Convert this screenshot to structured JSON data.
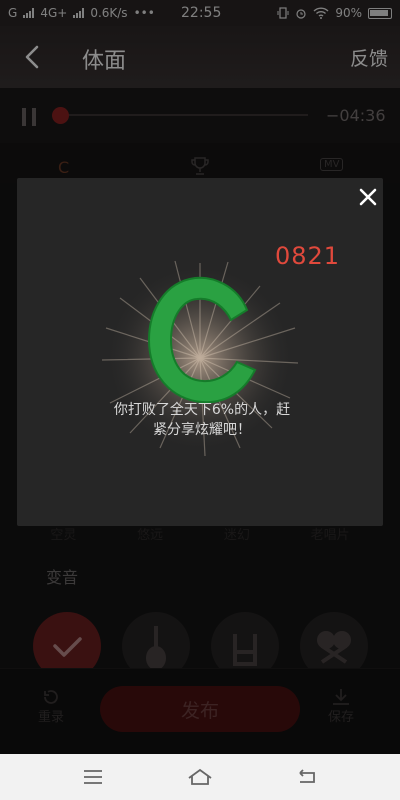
{
  "status_bar": {
    "carrier_left": "G",
    "network": "4G+",
    "speed": "0.6K/s",
    "more": "•••",
    "time": "22:55",
    "battery": "90%"
  },
  "header": {
    "title": "体面",
    "feedback_label": "反馈"
  },
  "player": {
    "time_remaining": "−04:36",
    "progress": 0.0
  },
  "tabs": {
    "grade_tab": "C",
    "cup_icon": "trophy-icon",
    "mv_tab": "MV"
  },
  "effects": {
    "labels": [
      "空灵",
      "悠远",
      "迷幻",
      "老唱片"
    ],
    "section_title": "变音"
  },
  "footer": {
    "rerecord_label": "重录",
    "publish_label": "发布",
    "save_label": "保存"
  },
  "modal": {
    "score": "0821",
    "grade": "C",
    "message": "你打败了全天下6%的人，赶紧分享炫耀吧！"
  },
  "colors": {
    "accent_red": "#e0493c",
    "grade_green": "#2a9a3e",
    "publish_bg": "#4a1212"
  }
}
